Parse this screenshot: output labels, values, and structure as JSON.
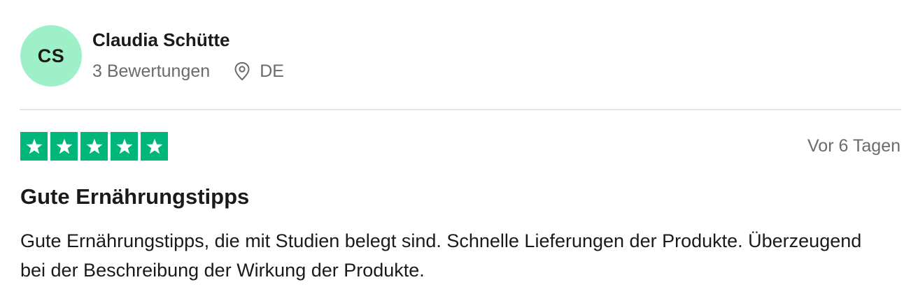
{
  "reviewer": {
    "initials": "CS",
    "name": "Claudia Schütte",
    "review_count": "3 Bewertungen",
    "country": "DE",
    "avatar_color": "#9ef0c9"
  },
  "review": {
    "rating": 5,
    "max_rating": 5,
    "star_color": "#00b67a",
    "date": "Vor 6 Tagen",
    "title": "Gute Ernährungstipps",
    "body": "Gute Ernährungstipps, die mit Studien belegt sind. Schnelle Lieferungen der Produkte. Überzeugend bei der Beschreibung der Wirkung der Produkte."
  },
  "icons": {
    "location": "location-pin-icon",
    "star": "star-icon"
  }
}
